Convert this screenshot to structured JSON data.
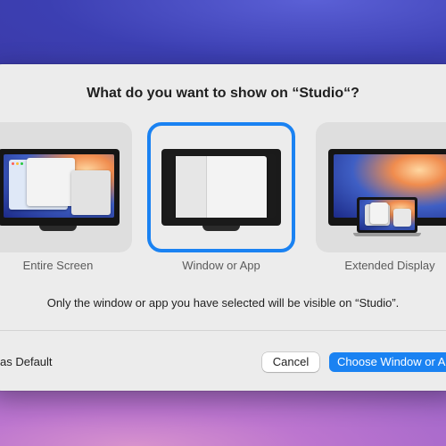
{
  "dialog": {
    "title": "What do you want to show on “Studio“?",
    "description": "Only the window or app you have selected will be visible on “Studio”.",
    "options": [
      {
        "label": "Entire Screen",
        "selected": false
      },
      {
        "label": "Window or App",
        "selected": true
      },
      {
        "label": "Extended Display",
        "selected": false
      }
    ],
    "default_label": "as Default",
    "cancel_label": "Cancel",
    "primary_label": "Choose Window or App"
  },
  "colors": {
    "accent": "#1a82f2",
    "dialog_bg": "#ececec",
    "tile_bg": "#dedede"
  }
}
